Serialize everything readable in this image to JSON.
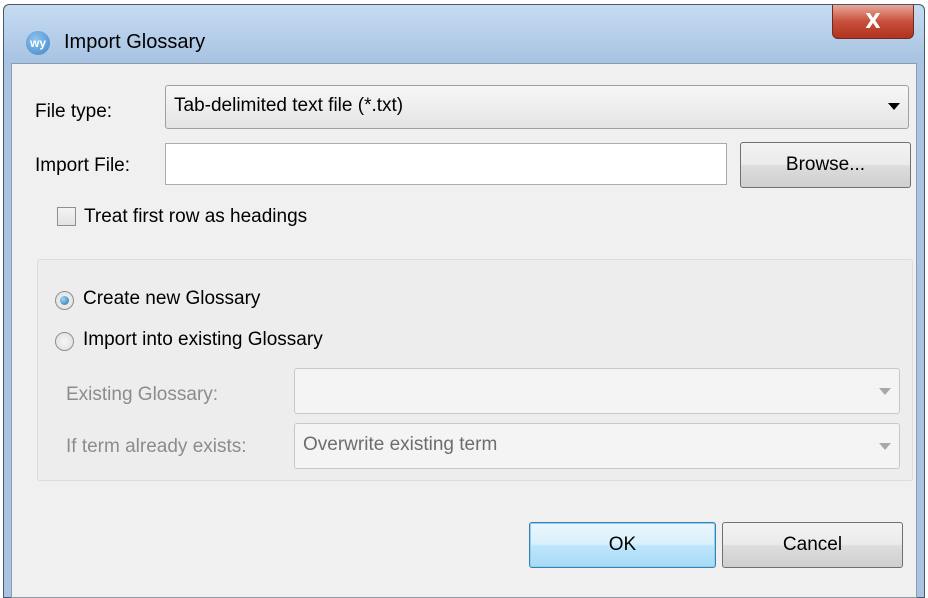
{
  "window": {
    "title": "Import Glossary",
    "icon_text": "wy",
    "close_symbol": "X"
  },
  "file_type": {
    "label": "File type:",
    "selected": "Tab-delimited text file (*.txt)"
  },
  "import_file": {
    "label": "Import File:",
    "value": "",
    "browse_label": "Browse..."
  },
  "headings_checkbox": {
    "label": "Treat first row as headings",
    "checked": false
  },
  "mode": {
    "create_new_label": "Create new Glossary",
    "create_new_selected": true,
    "import_existing_label": "Import into existing Glossary",
    "import_existing_selected": false
  },
  "existing_glossary": {
    "label": "Existing Glossary:",
    "selected": ""
  },
  "term_exists": {
    "label": "If term already exists:",
    "selected": "Overwrite existing term"
  },
  "footer": {
    "ok_label": "OK",
    "cancel_label": "Cancel"
  },
  "icons": [
    "app-icon",
    "close-icon",
    "dropdown-arrow-icon"
  ]
}
